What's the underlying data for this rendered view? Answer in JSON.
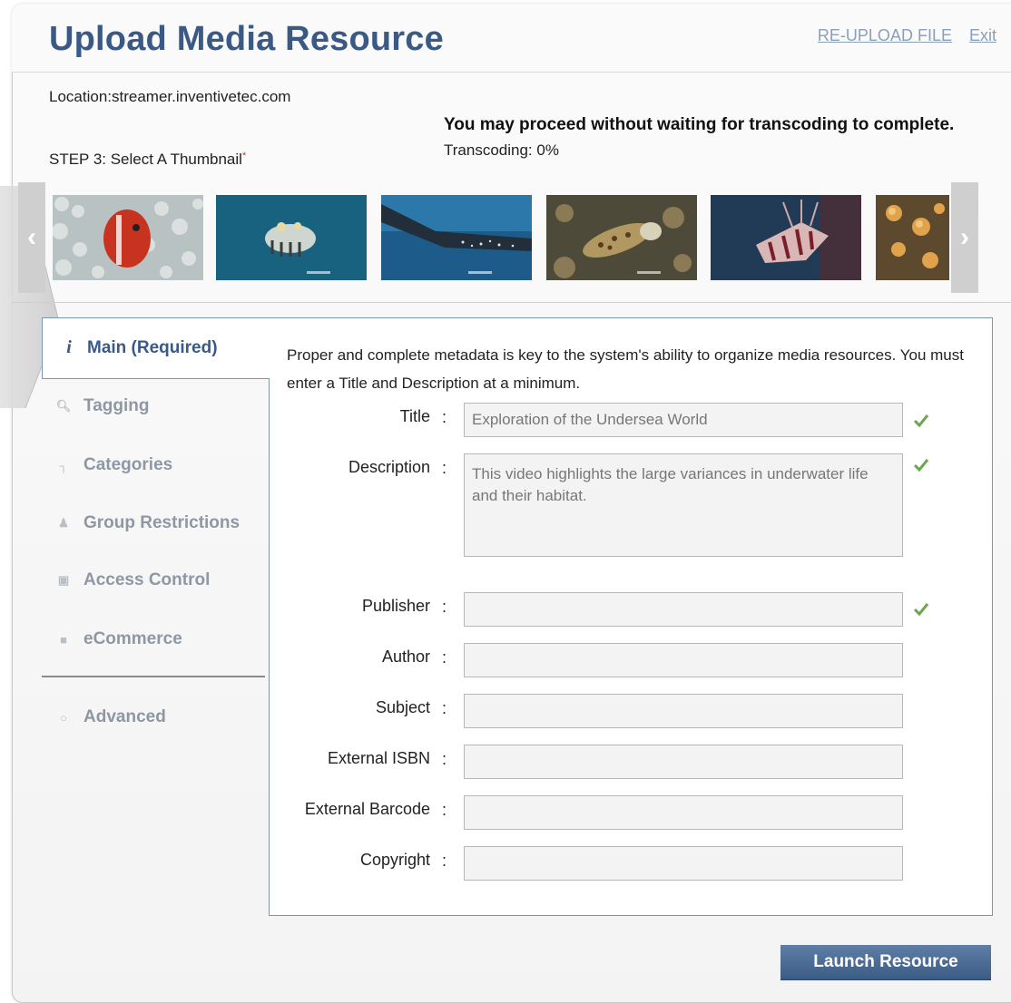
{
  "header": {
    "title": "Upload Media Resource",
    "reupload_link": "RE-UPLOAD FILE",
    "exit_link": "Exit"
  },
  "status": {
    "location": "Location:streamer.inventivetec.com",
    "proceed_notice": "You may proceed without waiting for transcoding to complete.",
    "transcoding": "Transcoding: 0%"
  },
  "step": {
    "label": "STEP 3: Select A Thumbnail",
    "required_mark": "*"
  },
  "carousel": {
    "prev": "‹",
    "next": "›"
  },
  "tabs": [
    {
      "label": "Main (Required)",
      "icon": "info-icon"
    },
    {
      "label": "Tagging",
      "icon": "magnifier-icon"
    },
    {
      "label": "Categories",
      "icon": "hierarchy-icon"
    },
    {
      "label": "Group Restrictions",
      "icon": "users-icon"
    },
    {
      "label": "Access Control",
      "icon": "lock-icon"
    },
    {
      "label": "eCommerce",
      "icon": "register-icon"
    },
    {
      "label": "Advanced",
      "icon": "gear-icon"
    }
  ],
  "form": {
    "intro": "Proper and complete metadata is key to the system's ability to organize media resources. You must enter a Title and Description at a minimum.",
    "title_label": "Title",
    "title_value": "Exploration of the Undersea World",
    "description_label": "Description",
    "description_value": "This video highlights the large variances in underwater life and their habitat.",
    "publisher_label": "Publisher",
    "author_label": "Author",
    "subject_label": "Subject",
    "isbn_label": "External ISBN",
    "barcode_label": "External Barcode",
    "copyright_label": "Copyright",
    "colon": ":"
  },
  "actions": {
    "launch": "Launch Resource"
  },
  "colors": {
    "brand_blue": "#3a5a85",
    "check_green": "#6aa84f"
  }
}
